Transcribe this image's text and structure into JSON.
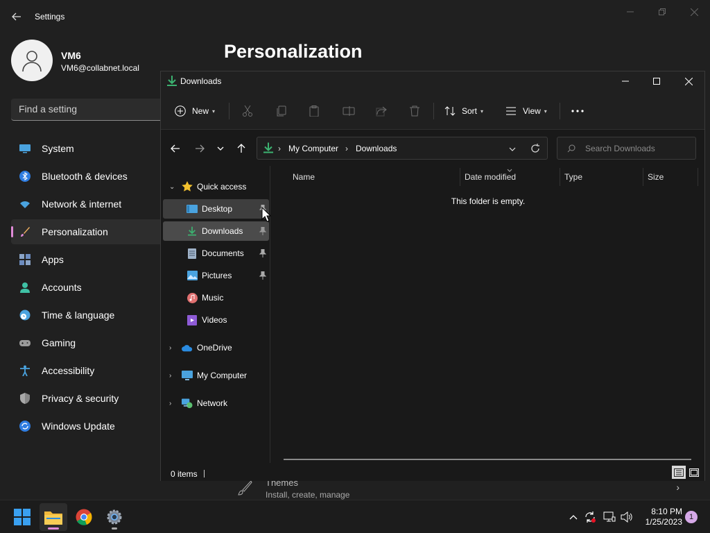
{
  "settings": {
    "title": "Settings",
    "profile": {
      "name": "VM6",
      "email": "VM6@collabnet.local"
    },
    "search_placeholder": "Find a setting",
    "heading": "Personalization",
    "nav": [
      {
        "label": "System",
        "icon": "monitor-icon"
      },
      {
        "label": "Bluetooth & devices",
        "icon": "bluetooth-icon"
      },
      {
        "label": "Network & internet",
        "icon": "wifi-icon"
      },
      {
        "label": "Personalization",
        "icon": "brush-icon",
        "active": true
      },
      {
        "label": "Apps",
        "icon": "apps-icon"
      },
      {
        "label": "Accounts",
        "icon": "person-icon"
      },
      {
        "label": "Time & language",
        "icon": "clock-globe-icon"
      },
      {
        "label": "Gaming",
        "icon": "gamepad-icon"
      },
      {
        "label": "Accessibility",
        "icon": "accessibility-icon"
      },
      {
        "label": "Privacy & security",
        "icon": "shield-icon"
      },
      {
        "label": "Windows Update",
        "icon": "update-icon"
      }
    ],
    "themes": {
      "title": "Themes",
      "subtitle": "Install, create, manage"
    }
  },
  "explorer": {
    "title": "Downloads",
    "toolbar": {
      "new_label": "New",
      "sort_label": "Sort",
      "view_label": "View"
    },
    "address": {
      "segments": [
        "My Computer",
        "Downloads"
      ]
    },
    "search_placeholder": "Search Downloads",
    "sidebar": {
      "quick_access": "Quick access",
      "items": [
        {
          "label": "Desktop",
          "icon": "desktop-icon",
          "pinned": true
        },
        {
          "label": "Downloads",
          "icon": "download-icon",
          "pinned": true
        },
        {
          "label": "Documents",
          "icon": "document-icon",
          "pinned": true
        },
        {
          "label": "Pictures",
          "icon": "pictures-icon",
          "pinned": true
        },
        {
          "label": "Music",
          "icon": "music-icon",
          "pinned": false
        },
        {
          "label": "Videos",
          "icon": "videos-icon",
          "pinned": false
        }
      ],
      "roots": [
        {
          "label": "OneDrive",
          "icon": "cloud-icon"
        },
        {
          "label": "My Computer",
          "icon": "computer-icon"
        },
        {
          "label": "Network",
          "icon": "network-icon"
        }
      ]
    },
    "columns": [
      "Name",
      "Date modified",
      "Type",
      "Size"
    ],
    "empty_message": "This folder is empty.",
    "status": "0 items"
  },
  "taskbar": {
    "apps": [
      "start-icon",
      "file-explorer-icon",
      "chrome-icon",
      "settings-icon"
    ],
    "time": "8:10 PM",
    "date": "1/25/2023",
    "notification_count": "1"
  },
  "colors": {
    "accent_pink": "#e08bd8",
    "download_green": "#3cb371",
    "background": "#202020"
  }
}
